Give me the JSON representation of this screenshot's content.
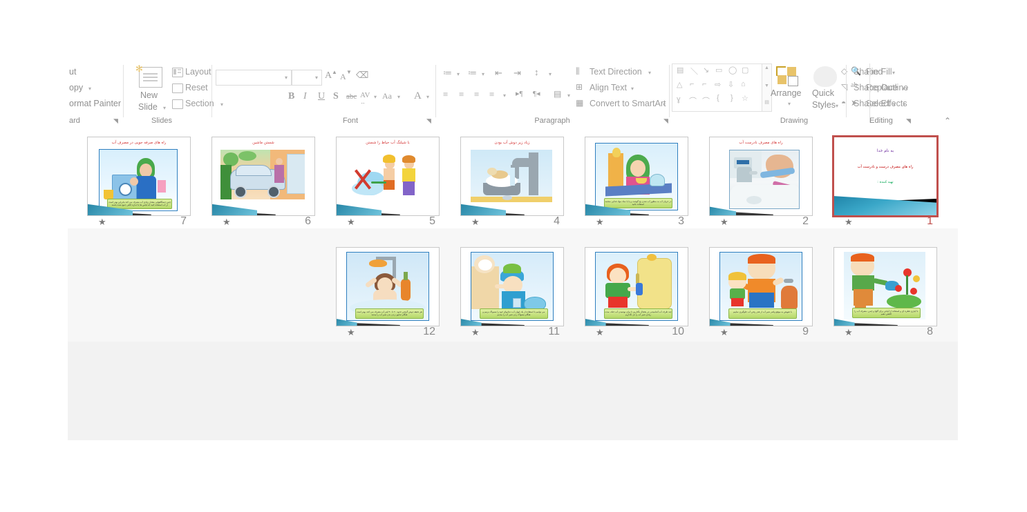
{
  "app": {
    "name": "PowerPoint Slide Sorter"
  },
  "ribbon": {
    "groups": [
      {
        "id": "clipboard",
        "label": "ard"
      },
      {
        "id": "slides",
        "label": "Slides"
      },
      {
        "id": "font",
        "label": "Font"
      },
      {
        "id": "paragraph",
        "label": "Paragraph"
      },
      {
        "id": "drawing",
        "label": "Drawing"
      },
      {
        "id": "editing",
        "label": "Editing"
      }
    ],
    "clipboard": {
      "cut_label": "ut",
      "copy_label": "opy",
      "format_painter_label": "ormat Painter",
      "group_label": "ard"
    },
    "slides": {
      "new_slide_label_line1": "New",
      "new_slide_label_line2": "Slide",
      "layout_label": "Layout",
      "reset_label": "Reset",
      "section_label": "Section",
      "group_label": "Slides"
    },
    "font": {
      "font_name_value": "",
      "font_name_placeholder": "",
      "font_size_value": "",
      "increase_font_label": "A",
      "decrease_font_label": "A",
      "clear_formatting_label": "clear-formatting-icon",
      "bold_label": "B",
      "italic_label": "I",
      "underline_label": "U",
      "shadow_label": "S",
      "strikethrough_label": "abc",
      "character_spacing_label": "AV",
      "change_case_label": "Aa",
      "font_color_label": "A",
      "group_label": "Font"
    },
    "paragraph": {
      "bullets_label": "bullets-icon",
      "numbering_label": "numbering-icon",
      "decrease_indent_label": "decrease-indent-icon",
      "increase_indent_label": "increase-indent-icon",
      "line_spacing_label": "line-spacing-icon",
      "text_direction_label": "Text Direction",
      "align_text_label": "Align Text",
      "convert_smartart_label": "Convert to SmartArt",
      "align_left_label": "align-left-icon",
      "align_center_label": "align-center-icon",
      "align_right_label": "align-right-icon",
      "justify_label": "justify-icon",
      "ltr_label": "ltr-icon",
      "rtl_label": "rtl-icon",
      "columns_label": "columns-icon",
      "group_label": "Paragraph"
    },
    "drawing": {
      "arrange_label": "Arrange",
      "quick_styles_label_line1": "Quick",
      "quick_styles_label_line2": "Styles",
      "shape_fill_label": "Shape Fill",
      "shape_outline_label": "Shape Outline",
      "shape_effects_label": "Shape Effects",
      "group_label": "Drawing"
    },
    "editing": {
      "find_label": "Find",
      "replace_label": "Replace",
      "select_label": "Select",
      "group_label": "Editing",
      "collapse_label": "collapse-ribbon-icon"
    }
  },
  "slides": [
    {
      "number": "7",
      "title": "راه های صرفه جویی در مصرف آب",
      "caption": "چنین دستگاههایی مقدار زیادی آب مصرف می کند بنابراین بهتر است از آب استفاده کنید که لباس ها با اندازه کافی جمع شده باشند",
      "kind": "illustration",
      "scene": "washing-machine",
      "star": "★",
      "selected": false
    },
    {
      "number": "6",
      "title": "شستن ماشین",
      "caption": "",
      "kind": "illustration",
      "scene": "car-wash",
      "star": "★",
      "selected": false
    },
    {
      "number": "5",
      "title": "با شیلنگ آب حیاط را شستن",
      "caption": "",
      "kind": "illustration",
      "scene": "hose-yard",
      "star": "★",
      "selected": false
    },
    {
      "number": "4",
      "title": "زیاد زیر دوش آب بودن",
      "caption": "",
      "kind": "illustration",
      "scene": "dog-faucet",
      "star": "★",
      "selected": false
    },
    {
      "number": "3",
      "title": "",
      "caption": "در جریان آب به منظور آب شدن یخ گوشت و یا با نمک مواد غذایی منجمد استفاده نکنید",
      "kind": "illustration",
      "scene": "kitchen-woman",
      "star": "★",
      "selected": false
    },
    {
      "number": "2",
      "title": "راه های مصرف نادرست آب",
      "caption": "",
      "kind": "photo",
      "scene": "faucet-hand-photo",
      "star": "★",
      "selected": false
    },
    {
      "number": "1",
      "title": "به نام خدا",
      "subtitle": "راه های مصرف درست و نادرست آب",
      "byline": "تهیه کننده :",
      "caption": "",
      "kind": "title-slide",
      "scene": "title",
      "star": "★",
      "selected": true
    },
    {
      "number": "12",
      "title": "",
      "caption": "هر دقیقه دوش گرفتن حدود ۲۰ تا ۳۰ لیتر آب مصرف می کند، بهتر است هنگام صابون زدن بدن شیر آب را ببندید",
      "kind": "illustration",
      "scene": "shower-boy",
      "star": "★",
      "selected": false
    },
    {
      "number": "11",
      "title": "",
      "caption": "می توانیم با استفاده از یک لیوان آب دندانهای خود را مسواک بزنیم و هنگام مسواک زدن شیر آب را ببندیم",
      "kind": "illustration",
      "scene": "brushing-teeth",
      "star": "★",
      "selected": false
    },
    {
      "number": "10",
      "title": "",
      "caption": "چند ظرف آب آشامیدنی در یخچال بگذاریم تا برای نوشیدن آب خنک، مدت زیادی شیر آب را باز نگذاریم",
      "kind": "illustration",
      "scene": "fridge-boy",
      "star": "★",
      "selected": false
    },
    {
      "number": "9",
      "title": "",
      "caption": "با تعویض به موقع واشر شیر آب از هدر رفتن آب جلوگیری نماییم",
      "kind": "illustration",
      "scene": "plumber-child",
      "star": "★",
      "selected": false
    },
    {
      "number": "8",
      "title": "",
      "caption": "با آبیاری قطره ای و استفاده از آبپاش برای گلها و چمن، مصرف آب را کاهش دهیم",
      "kind": "illustration",
      "scene": "watering-flowers",
      "star": "★",
      "selected": false
    }
  ],
  "colors": {
    "selection": "#c0504d",
    "slide_title_red": "#d32f2f",
    "sorter_background": "#f2f2f2",
    "ribbon_text": "#9d9d9d"
  }
}
